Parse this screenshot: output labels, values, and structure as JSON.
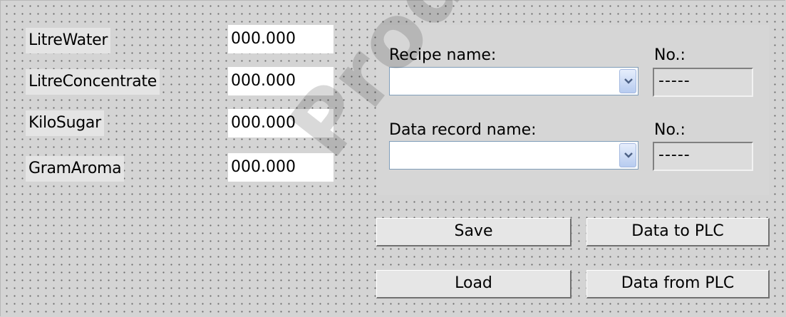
{
  "variables": [
    {
      "label": "LitreWater",
      "value": "000.000"
    },
    {
      "label": "LitreConcentrate",
      "value": "000.000"
    },
    {
      "label": "KiloSugar",
      "value": "000.000"
    },
    {
      "label": "GramAroma",
      "value": "000.000"
    }
  ],
  "recipe": {
    "recipe_name_label": "Recipe name:",
    "recipe_name_value": "",
    "recipe_no_label": "No.:",
    "recipe_no_value": "-----",
    "data_record_label": "Data record name:",
    "data_record_value": "",
    "data_record_no_label": "No.:",
    "data_record_no_value": "-----"
  },
  "buttons": {
    "save": "Save",
    "data_to_plc": "Data to PLC",
    "load": "Load",
    "data_from_plc": "Data from PLC"
  },
  "watermark": "ProductManuals",
  "colors": {
    "background": "#d4d4d4",
    "panel": "#d6d6d6",
    "combo_border": "#7f9db9"
  }
}
